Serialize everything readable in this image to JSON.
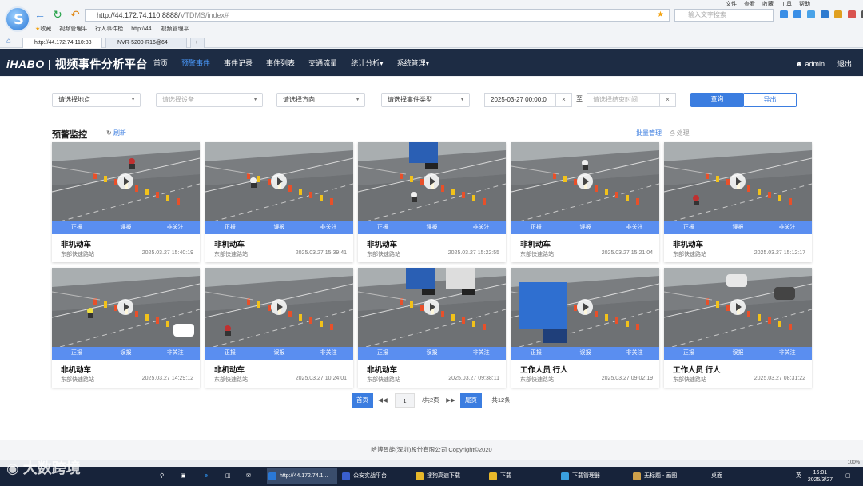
{
  "browser": {
    "url_host": "http://44.172.74.110:8888/",
    "url_path": "VTDMS/index#",
    "search_placeholder": "输入文字搜索",
    "menu": [
      "文件",
      "查看",
      "收藏",
      "工具",
      "帮助"
    ],
    "favorites": [
      "收藏",
      "视频管理平",
      "行人事件检",
      "http://44.",
      "视频管理平"
    ],
    "tabs": [
      "http://44.172.74.110:88",
      "NVR-5200-R16@64"
    ]
  },
  "app": {
    "logo": "iHABO",
    "title": "视频事件分析平台",
    "nav": [
      "首页",
      "预警事件",
      "事件记录",
      "事件列表",
      "交通流量",
      "统计分析▾",
      "系统管理▾"
    ],
    "user": "admin",
    "logout": "退出"
  },
  "filters": {
    "location": "请选择地点",
    "device": "请选择设备",
    "direction": "请选择方向",
    "event_type": "请选择事件类型",
    "start_time": "2025-03-27 00:00:0",
    "to": "至",
    "end_placeholder": "请选择结束时间",
    "query": "查询",
    "export": "导出"
  },
  "panel": {
    "title": "预警监控",
    "refresh": "刷新",
    "batch": "批量管理",
    "handle": "处理"
  },
  "card_actions": [
    "正报",
    "误报",
    "非关注"
  ],
  "cards": [
    {
      "title": "非机动车",
      "location": "东部快速路站",
      "time": "2025.03.27 15:40:19"
    },
    {
      "title": "非机动车",
      "location": "东部快速路站",
      "time": "2025.03.27 15:39:41"
    },
    {
      "title": "非机动车",
      "location": "东部快速路站",
      "time": "2025.03.27 15:22:55"
    },
    {
      "title": "非机动车",
      "location": "东部快速路站",
      "time": "2025.03.27 15:21:04"
    },
    {
      "title": "非机动车",
      "location": "东部快速路站",
      "time": "2025.03.27 15:12:17"
    },
    {
      "title": "非机动车",
      "location": "东部快速路站",
      "time": "2025.03.27 14:29:12"
    },
    {
      "title": "非机动车",
      "location": "东部快速路站",
      "time": "2025.03.27 10:24:01"
    },
    {
      "title": "非机动车",
      "location": "东部快速路站",
      "time": "2025.03.27 09:38:11"
    },
    {
      "title": "工作人员 行人",
      "location": "东部快速路站",
      "time": "2025.03.27 09:02:19"
    },
    {
      "title": "工作人员 行人",
      "location": "东部快速路站",
      "time": "2025.03.27 08:31:22"
    }
  ],
  "pager": {
    "first": "首页",
    "page": "1",
    "total_pages": "/共2页",
    "last": "尾页",
    "total": "共12条"
  },
  "footer": "哈博智能(深圳)股份有限公司 Copyright©2020",
  "taskbar": {
    "items": [
      "http://44.172.74.1...",
      "公安实战平台",
      "搜狗高速下载",
      "下载",
      "下载管理器",
      "无标题 - 画图"
    ],
    "tray_left": "桌面",
    "lang": "英",
    "time": "16:01",
    "date": "2025/3/27",
    "zoom": "100%",
    "watermark": "大数跨境"
  }
}
